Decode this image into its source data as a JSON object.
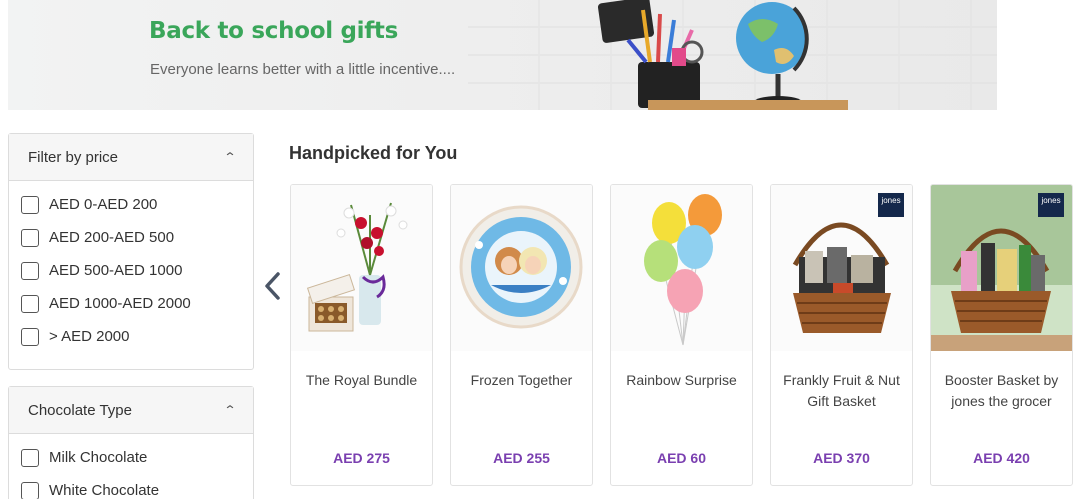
{
  "banner": {
    "title": "Back to school gifts",
    "subtitle": "Everyone learns better with a little incentive...."
  },
  "filters": [
    {
      "title": "Filter by price",
      "options": [
        "AED 0-AED 200",
        "AED 200-AED 500",
        "AED 500-AED 1000",
        "AED 1000-AED 2000",
        "> AED 2000"
      ]
    },
    {
      "title": "Chocolate Type",
      "options": [
        "Milk Chocolate",
        "White Chocolate"
      ]
    }
  ],
  "section": {
    "title": "Handpicked for You"
  },
  "products": [
    {
      "name": "The Royal Bundle",
      "price": "AED 275"
    },
    {
      "name": "Frozen Together",
      "price": "AED 255"
    },
    {
      "name": "Rainbow Surprise",
      "price": "AED 60"
    },
    {
      "name": "Frankly Fruit & Nut Gift Basket",
      "price": "AED 370",
      "badge": "jones"
    },
    {
      "name": "Booster Basket by jones the grocer",
      "price": "AED 420",
      "badge": "jones"
    }
  ],
  "icons": {
    "prev": "chevron-left-icon",
    "collapse": "chevron-up-icon"
  },
  "colors": {
    "banner_title": "#3aa65a",
    "price": "#7a3fb0"
  }
}
